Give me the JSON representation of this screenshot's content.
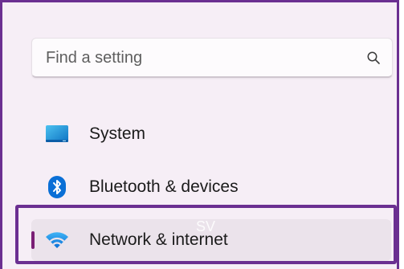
{
  "search": {
    "placeholder": "Find a setting",
    "icon": "search-icon"
  },
  "nav": {
    "items": [
      {
        "label": "System",
        "icon": "monitor-icon",
        "selected": false
      },
      {
        "label": "Bluetooth & devices",
        "icon": "bluetooth-icon",
        "selected": false
      },
      {
        "label": "Network & internet",
        "icon": "wifi-icon",
        "selected": true
      }
    ]
  },
  "annotation": {
    "highlight_color": "#6b2f91",
    "watermark": "SV"
  },
  "colors": {
    "accent": "#7a1f75",
    "background": "#f6eef6",
    "selected_row": "#ebe3eb",
    "system_icon": "#1a8fd1",
    "bluetooth_icon": "#0a6fd6",
    "wifi_icon": "#1389e6"
  }
}
